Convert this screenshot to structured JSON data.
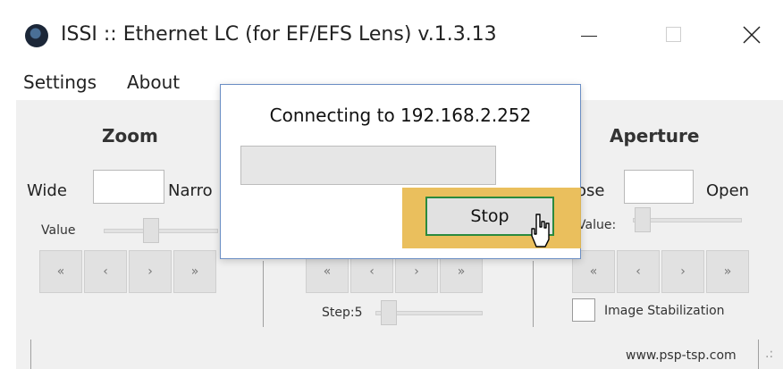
{
  "window": {
    "title": "ISSI :: Ethernet LC (for EF/EFS Lens) v.1.3.13"
  },
  "menu": [
    "Settings",
    "About"
  ],
  "zoom": {
    "header": "Zoom",
    "left_label": "Wide",
    "right_label": "Narro",
    "value_label": "Value",
    "buttons": [
      "«",
      "‹",
      "›",
      "»"
    ]
  },
  "focus": {
    "buttons": [
      "«",
      "‹",
      "›",
      "»"
    ],
    "step_label": "Step:5"
  },
  "aperture": {
    "header": "Aperture",
    "left_label": "lose",
    "right_label": "Open",
    "value_label": "Value:",
    "buttons": [
      "«",
      "‹",
      "›",
      "»"
    ],
    "stabilization_label": "Image Stabilization"
  },
  "footer": {
    "website": "www.psp-tsp.com"
  },
  "dialog": {
    "message": "Connecting to 192.168.2.252",
    "stop_label": "Stop"
  },
  "colors": {
    "highlight": "#e8b84b",
    "stop_border": "#2a8a3e",
    "dialog_border": "#6b8ec4"
  },
  "icons": [
    "app-lens-icon",
    "minimize-icon",
    "maximize-icon",
    "close-icon",
    "mouse-cursor-icon"
  ]
}
